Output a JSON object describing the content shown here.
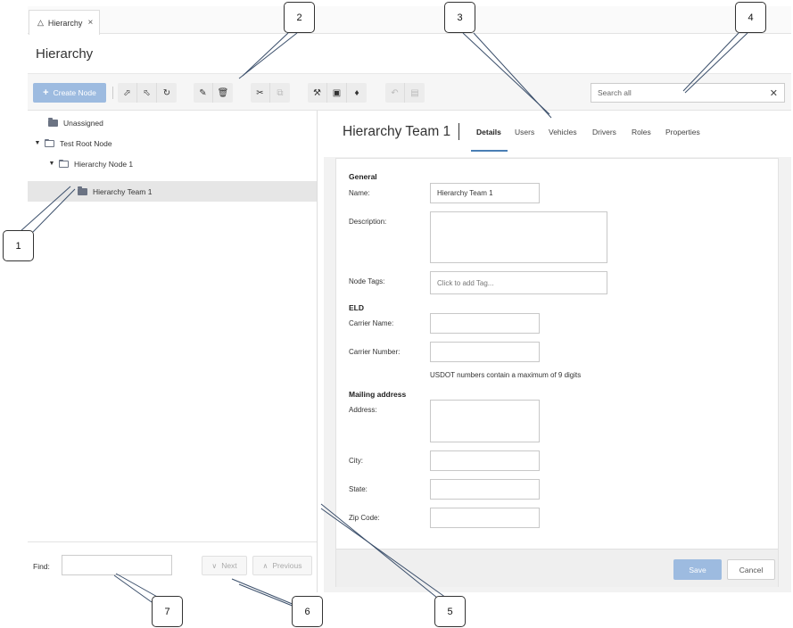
{
  "tab": {
    "label": "Hierarchy",
    "icon": "sitemap-icon"
  },
  "page": {
    "title": "Hierarchy"
  },
  "toolbar": {
    "create_label": "Create Node",
    "search_placeholder": "Search all"
  },
  "tree": [
    {
      "label": "Unassigned",
      "level": 0,
      "expanded": null,
      "open_icon": false
    },
    {
      "label": "Test Root Node",
      "level": 0,
      "expanded": true,
      "open_icon": true
    },
    {
      "label": "Hierarchy Node 1",
      "level": 1,
      "expanded": true,
      "open_icon": true
    },
    {
      "label": "Hierarchy Team 1",
      "level": 2,
      "expanded": null,
      "open_icon": false,
      "selected": true
    }
  ],
  "footer": {
    "find_label": "Find:",
    "next_label": "Next",
    "previous_label": "Previous"
  },
  "details": {
    "title": "Hierarchy Team 1",
    "tabs": [
      "Details",
      "Users",
      "Vehicles",
      "Drivers",
      "Roles",
      "Properties"
    ],
    "active_tab": "Details",
    "sections": {
      "general": "General",
      "eld": "ELD",
      "mailing": "Mailing address"
    },
    "labels": {
      "name": "Name:",
      "description": "Description:",
      "node_tags": "Node Tags:",
      "carrier_name": "Carrier Name:",
      "carrier_number": "Carrier Number:",
      "address": "Address:",
      "city": "City:",
      "state": "State:",
      "zip": "Zip Code:"
    },
    "values": {
      "name": "Hierarchy Team 1",
      "description": "",
      "carrier_name": "",
      "carrier_number": "",
      "address": "",
      "city": "",
      "state": "",
      "zip": ""
    },
    "node_tags_placeholder": "Click to add Tag...",
    "carrier_number_hint": "USDOT numbers contain a maximum of 9 digits",
    "save_label": "Save",
    "cancel_label": "Cancel"
  },
  "callouts": [
    "1",
    "2",
    "3",
    "4",
    "5",
    "6",
    "7"
  ],
  "colors": {
    "primary_disabled": "#9dbbe0",
    "accent": "#4a7fb5"
  }
}
